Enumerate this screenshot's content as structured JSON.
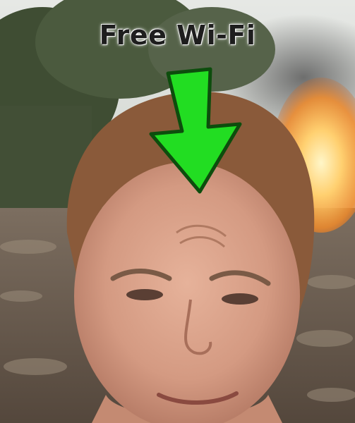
{
  "caption": {
    "text": "Free Wi-Fi"
  },
  "arrow": {
    "direction": "down",
    "color": "#22dd22",
    "outline_color": "#0d4d0d"
  },
  "photo": {
    "subject": "person-selfie",
    "background": "burning-brush-fire",
    "colors": {
      "sky": "#d9dcd8",
      "trees": "#4a5a3c",
      "fire": "#ffb347",
      "hair": "#8a5a3a",
      "skin": "#d49a82",
      "ground": "#6a5c4e"
    }
  }
}
